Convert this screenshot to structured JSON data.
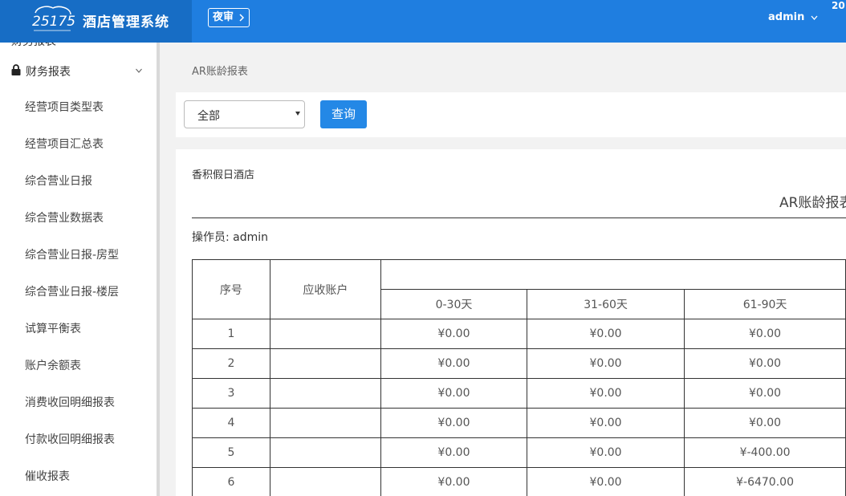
{
  "header": {
    "logo_text": "25175",
    "app_title": "酒店管理系统",
    "night_audit_label": "夜审",
    "user": "admin",
    "date_fragment": "20"
  },
  "sidebar": {
    "cut_item": "财务报表",
    "group_label": "财务报表",
    "items": [
      {
        "label": "经营项目类型表"
      },
      {
        "label": "经营项目汇总表"
      },
      {
        "label": "综合营业日报"
      },
      {
        "label": "综合营业数据表"
      },
      {
        "label": "综合营业日报-房型"
      },
      {
        "label": "综合营业日报-楼层"
      },
      {
        "label": "试算平衡表"
      },
      {
        "label": "账户余额表"
      },
      {
        "label": "消费收回明细报表"
      },
      {
        "label": "付款收回明细报表"
      },
      {
        "label": "催收报表"
      }
    ]
  },
  "breadcrumb": "AR账龄报表",
  "filter": {
    "selected": "全部",
    "query_label": "查询"
  },
  "report": {
    "hotel": "香积假日酒店",
    "title": "AR账龄报表",
    "operator": "操作员: admin",
    "columns": {
      "index": "序号",
      "account": "应收账户",
      "aging": [
        "0-30天",
        "31-60天",
        "61-90天"
      ]
    },
    "rows": [
      {
        "no": "1",
        "account": "",
        "d0_30": "¥0.00",
        "d31_60": "¥0.00",
        "d61_90": "¥0.00"
      },
      {
        "no": "2",
        "account": "",
        "d0_30": "¥0.00",
        "d31_60": "¥0.00",
        "d61_90": "¥0.00"
      },
      {
        "no": "3",
        "account": "",
        "d0_30": "¥0.00",
        "d31_60": "¥0.00",
        "d61_90": "¥0.00"
      },
      {
        "no": "4",
        "account": "",
        "d0_30": "¥0.00",
        "d31_60": "¥0.00",
        "d61_90": "¥0.00"
      },
      {
        "no": "5",
        "account": "",
        "d0_30": "¥0.00",
        "d31_60": "¥0.00",
        "d61_90": "¥-400.00"
      },
      {
        "no": "6",
        "account": "",
        "d0_30": "¥0.00",
        "d31_60": "¥0.00",
        "d61_90": "¥-6470.00"
      }
    ]
  },
  "colors": {
    "topbar": "#1f7ee0",
    "logo_bg": "#176dc5",
    "button": "#2488e6"
  }
}
